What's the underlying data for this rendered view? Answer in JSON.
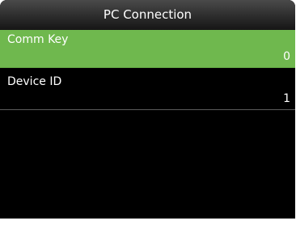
{
  "header": {
    "title": "PC Connection"
  },
  "menu": {
    "items": [
      {
        "label": "Comm Key",
        "value": "0",
        "selected": true
      },
      {
        "label": "Device ID",
        "value": "1",
        "selected": false
      }
    ]
  },
  "colors": {
    "selected_background": "#6fb84e",
    "screen_background": "#000000",
    "text": "#ffffff"
  }
}
